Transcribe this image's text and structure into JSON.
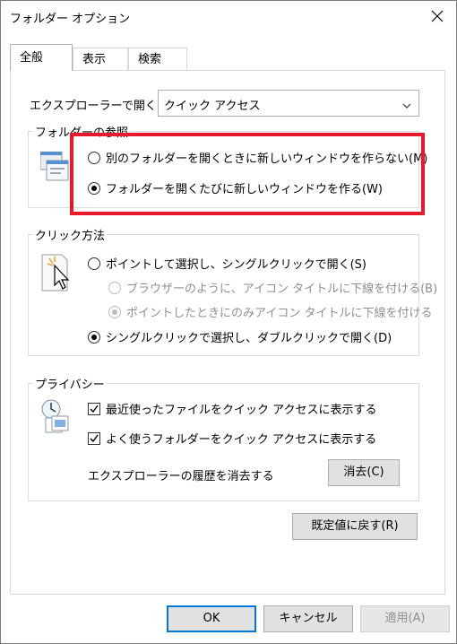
{
  "window": {
    "title": "フォルダー オプション",
    "close_icon": "close-icon"
  },
  "tabs": [
    {
      "label": "全般",
      "active": true
    },
    {
      "label": "表示",
      "active": false
    },
    {
      "label": "検索",
      "active": false
    }
  ],
  "open_explorer": {
    "label": "エクスプローラーで開く:",
    "value": "クイック アクセス"
  },
  "browse_folders": {
    "title": "フォルダーの参照",
    "options": [
      {
        "label": "別のフォルダーを開くときに新しいウィンドウを作らない(M)",
        "checked": false
      },
      {
        "label": "フォルダーを開くたびに新しいウィンドウを作る(W)",
        "checked": true
      }
    ]
  },
  "click_items": {
    "title": "クリック方法",
    "single_click": "ポイントして選択し、シングルクリックで開く(S)",
    "underline_browser": "ブラウザーのように、アイコン タイトルに下線を付ける(B)",
    "underline_point": "ポイントしたときにのみアイコン タイトルに下線を付ける",
    "double_click": "シングルクリックで選択し、ダブルクリックで開く(D)"
  },
  "privacy": {
    "title": "プライバシー",
    "recent_files": "最近使ったファイルをクイック アクセスに表示する",
    "frequent_folders": "よく使うフォルダーをクイック アクセスに表示する",
    "clear_history_label": "エクスプローラーの履歴を消去する",
    "clear_button": "消去(C)"
  },
  "restore_defaults": "既定値に戻す(R)",
  "footer": {
    "ok": "OK",
    "cancel": "キャンセル",
    "apply": "適用(A)"
  },
  "colors": {
    "highlight": "#e8192c",
    "focus": "#0078d7"
  }
}
